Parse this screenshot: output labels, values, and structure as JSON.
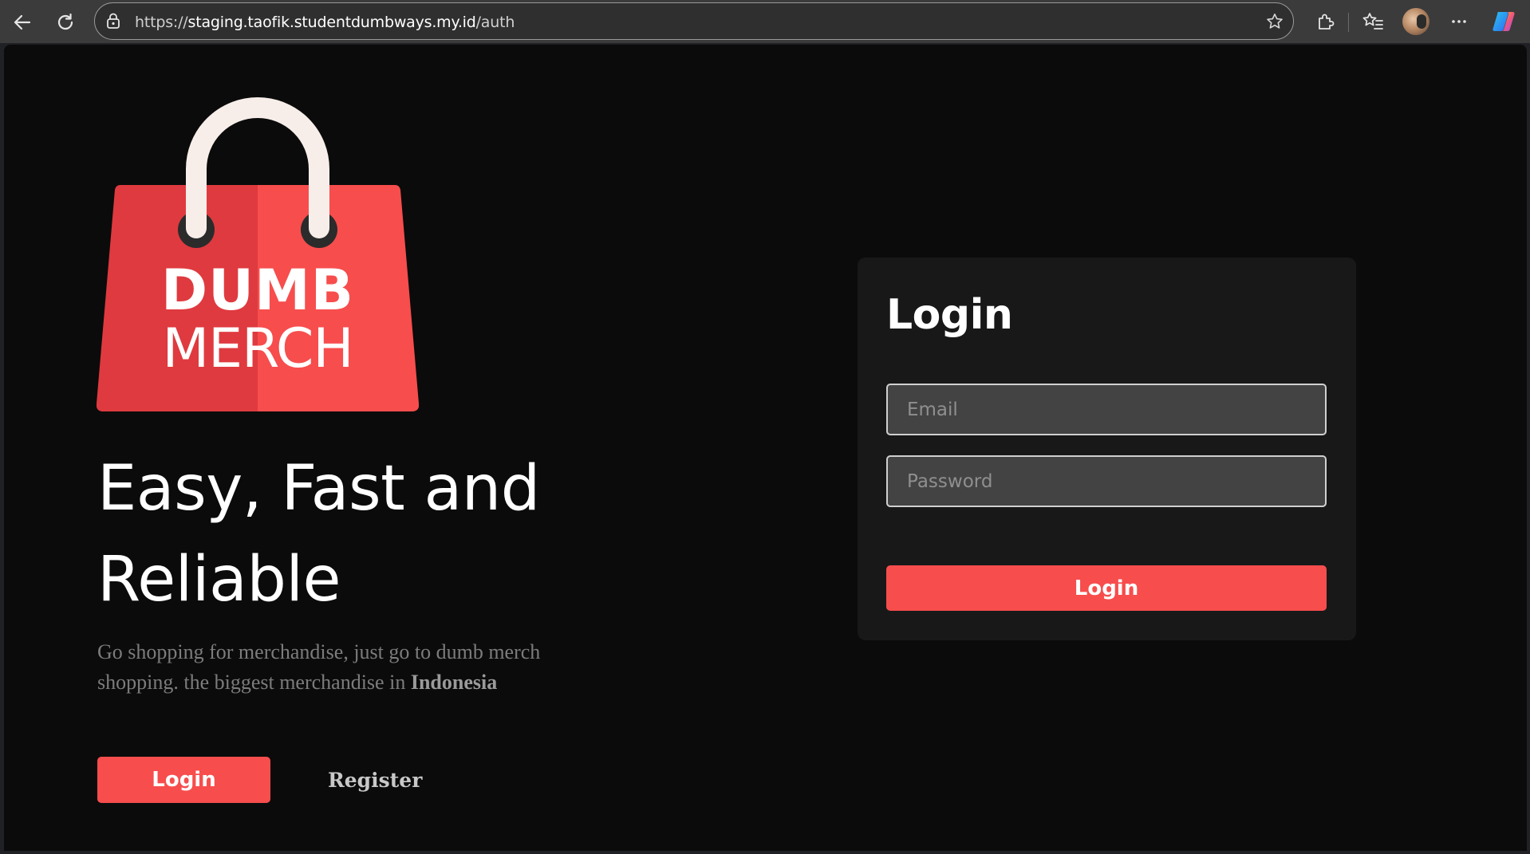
{
  "browser": {
    "url_scheme": "https://",
    "url_host": "staging.taofik.studentdumbways.my.id",
    "url_path": "/auth",
    "icons": {
      "back": "back-arrow-icon",
      "reload": "reload-icon",
      "lock": "lock-icon",
      "favorite": "star-icon",
      "extensions": "extensions-icon",
      "favorites": "favorites-icon",
      "profile": "avatar",
      "menu": "more-options-icon",
      "copilot": "copilot-icon"
    }
  },
  "logo": {
    "line1": "DUMB",
    "line2": "MERCH",
    "colors": {
      "bag_left": "#DF3A3F",
      "bag_right": "#F74D4D",
      "handle": "#F7EEEA",
      "rivet": "#2B2B2B"
    }
  },
  "hero": {
    "tagline": "Easy, Fast and Reliable",
    "description_text": "Go shopping for merchandise, just go to dumb merch shopping. the biggest merchandise in ",
    "description_bold": "Indonesia",
    "login_label": "Login",
    "register_label": "Register"
  },
  "login_card": {
    "title": "Login",
    "email_placeholder": "Email",
    "password_placeholder": "Password",
    "submit_label": "Login"
  },
  "theme": {
    "background": "#0B0B0B",
    "card": "#181818",
    "accent": "#F74D4D",
    "input_bg": "#434343"
  }
}
